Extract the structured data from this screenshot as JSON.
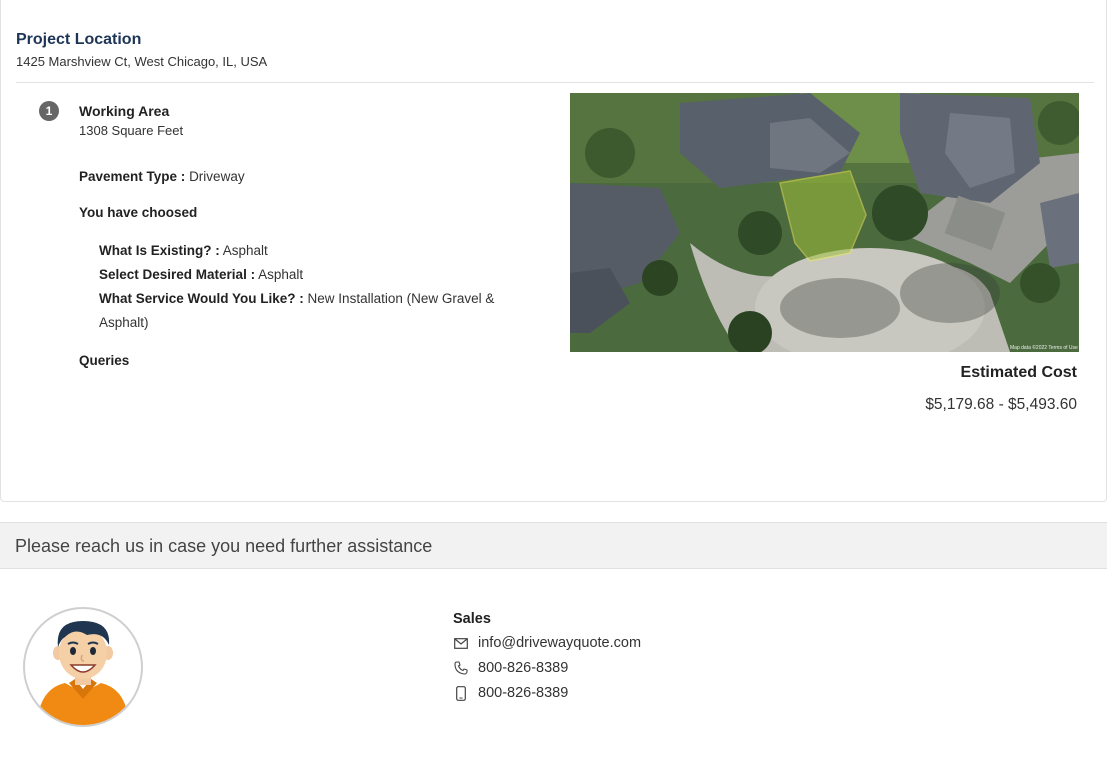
{
  "project": {
    "location_title": "Project Location",
    "address": "1425 Marshview Ct, West Chicago, IL, USA"
  },
  "working_area": {
    "step": "1",
    "title": "Working Area",
    "value": "1308 Square Feet"
  },
  "pavement": {
    "label": "Pavement Type :",
    "value": "Driveway"
  },
  "choices": {
    "heading": "You have choosed",
    "items": [
      {
        "label": "What Is Existing? :",
        "value": "Asphalt"
      },
      {
        "label": "Select Desired Material :",
        "value": "Asphalt"
      },
      {
        "label": "What Service Would You Like? :",
        "value": "New Installation (New Gravel & Asphalt)"
      }
    ]
  },
  "queries_label": "Queries",
  "map": {
    "attribution": "Map data ©2022  Terms of Use"
  },
  "estimate": {
    "label": "Estimated Cost",
    "value": "$5,179.68 - $5,493.60"
  },
  "assist": {
    "text": "Please reach us in case you need further assistance"
  },
  "sales": {
    "title": "Sales",
    "email": "info@drivewayquote.com",
    "phone": "800-826-8389",
    "mobile": "800-826-8389"
  },
  "icons": {
    "email": "mail-icon",
    "phone": "phone-icon",
    "mobile": "mobile-icon"
  }
}
